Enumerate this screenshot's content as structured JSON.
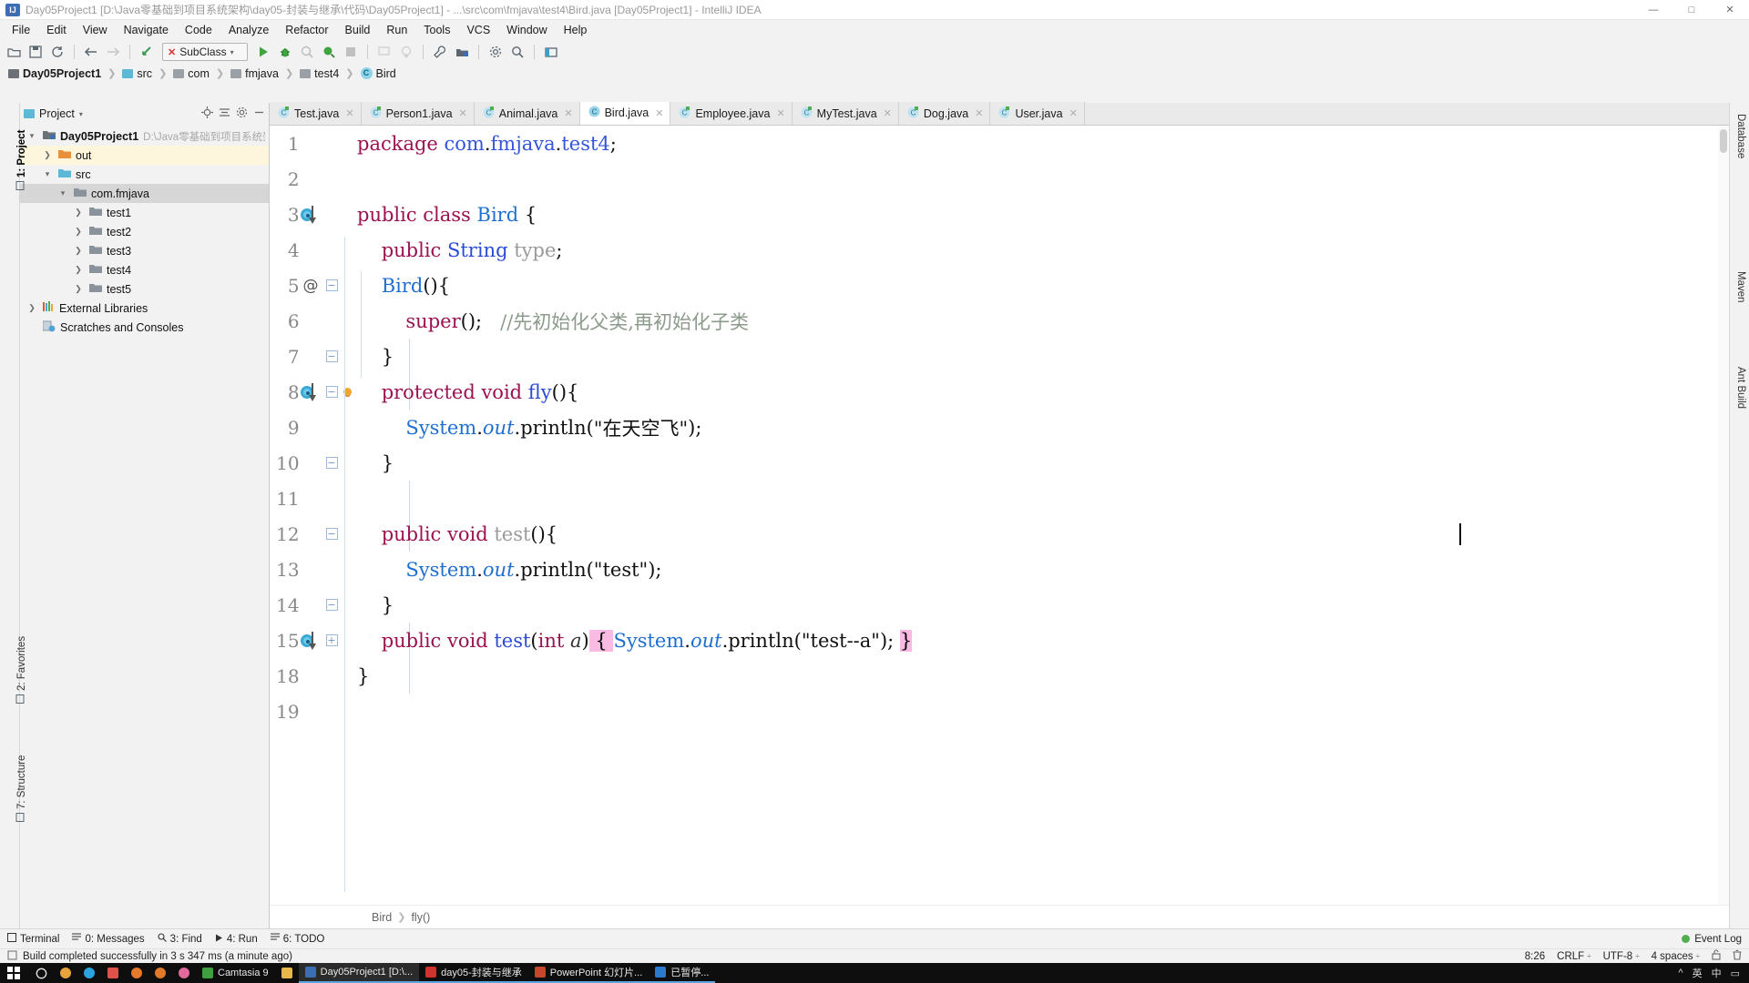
{
  "window": {
    "title": "Day05Project1 [D:\\Java零基础到项目系统架构\\day05-封装与继承\\代码\\Day05Project1] - ...\\src\\com\\fmjava\\test4\\Bird.java [Day05Project1] - IntelliJ IDEA",
    "app_badge": "IJ",
    "minimize": "—",
    "maximize": "□",
    "close": "✕"
  },
  "menubar": {
    "items": [
      "File",
      "Edit",
      "View",
      "Navigate",
      "Code",
      "Analyze",
      "Refactor",
      "Build",
      "Run",
      "Tools",
      "VCS",
      "Window",
      "Help"
    ]
  },
  "toolbar": {
    "run_config": {
      "label": "SubClass",
      "error_mark": "✕",
      "caret": "▾"
    },
    "icons": [
      "open-folder-icon",
      "save-all-icon",
      "sync-icon",
      "back-icon",
      "forward-icon",
      "flash-icon"
    ],
    "run_icons": [
      "run-icon",
      "debug-icon",
      "run-with-coverage-icon",
      "profile-icon",
      "stop-icon",
      "attach-icon",
      "update-icon"
    ],
    "right_icons": [
      "wrench-icon",
      "project-structure-icon",
      "settings-icon",
      "search-everywhere-icon",
      "layout-icon"
    ]
  },
  "breadcrumb": {
    "items": [
      {
        "label": "Day05Project1",
        "icon": "project-module-icon",
        "bold": true
      },
      {
        "label": "src",
        "icon": "source-folder-icon",
        "bold": false
      },
      {
        "label": "com",
        "icon": "folder-icon",
        "bold": false
      },
      {
        "label": "fmjava",
        "icon": "folder-icon",
        "bold": false
      },
      {
        "label": "test4",
        "icon": "folder-icon",
        "bold": false
      },
      {
        "label": "Bird",
        "icon": "class-icon",
        "bold": false
      }
    ],
    "separator": "❯"
  },
  "left_rail": {
    "tabs": [
      {
        "label": "1: Project",
        "active": true
      },
      {
        "label": "2: Favorites",
        "active": false
      },
      {
        "label": "7: Structure",
        "active": false
      }
    ]
  },
  "right_rail": {
    "tabs": [
      {
        "label": "Database",
        "active": false
      },
      {
        "label": "Maven",
        "active": false
      },
      {
        "label": "Ant Build",
        "active": false
      }
    ]
  },
  "project_panel": {
    "title": "Project",
    "title_caret": "▾",
    "actions": [
      "locate-icon",
      "collapse-all-icon",
      "settings-icon",
      "hide-icon"
    ],
    "tree": [
      {
        "depth": 0,
        "arrow": "▾",
        "icon": "project-module-icon",
        "label": "Day05Project1",
        "bold": true,
        "path": "D:\\Java零基础到项目系统架",
        "state": "normal"
      },
      {
        "depth": 1,
        "arrow": "❯",
        "icon": "out-folder-icon",
        "label": "out",
        "bold": false,
        "path": "",
        "state": "highlight"
      },
      {
        "depth": 1,
        "arrow": "▾",
        "icon": "source-folder-icon",
        "label": "src",
        "bold": false,
        "path": "",
        "state": "normal"
      },
      {
        "depth": 2,
        "arrow": "▾",
        "icon": "package-icon",
        "label": "com.fmjava",
        "bold": false,
        "path": "",
        "state": "selected"
      },
      {
        "depth": 3,
        "arrow": "❯",
        "icon": "package-icon",
        "label": "test1",
        "bold": false,
        "path": "",
        "state": "normal"
      },
      {
        "depth": 3,
        "arrow": "❯",
        "icon": "package-icon",
        "label": "test2",
        "bold": false,
        "path": "",
        "state": "normal"
      },
      {
        "depth": 3,
        "arrow": "❯",
        "icon": "package-icon",
        "label": "test3",
        "bold": false,
        "path": "",
        "state": "normal"
      },
      {
        "depth": 3,
        "arrow": "❯",
        "icon": "package-icon",
        "label": "test4",
        "bold": false,
        "path": "",
        "state": "normal"
      },
      {
        "depth": 3,
        "arrow": "❯",
        "icon": "package-icon",
        "label": "test5",
        "bold": false,
        "path": "",
        "state": "normal"
      },
      {
        "depth": 0,
        "arrow": "❯",
        "icon": "libraries-icon",
        "label": "External Libraries",
        "bold": false,
        "path": "",
        "state": "normal"
      },
      {
        "depth": 0,
        "arrow": "",
        "icon": "scratches-icon",
        "label": "Scratches and Consoles",
        "bold": false,
        "path": "",
        "state": "normal"
      }
    ]
  },
  "editor_tabs": [
    {
      "label": "Test.java",
      "active": false,
      "close": "✕"
    },
    {
      "label": "Person1.java",
      "active": false,
      "close": "✕"
    },
    {
      "label": "Animal.java",
      "active": false,
      "close": "✕"
    },
    {
      "label": "Bird.java",
      "active": true,
      "close": "✕"
    },
    {
      "label": "Employee.java",
      "active": false,
      "close": "✕"
    },
    {
      "label": "MyTest.java",
      "active": false,
      "close": "✕"
    },
    {
      "label": "Dog.java",
      "active": false,
      "close": "✕"
    },
    {
      "label": "User.java",
      "active": false,
      "close": "✕"
    }
  ],
  "code": {
    "lines": [
      {
        "num": "1",
        "gutter_icon": "",
        "fold": "",
        "lamp": false,
        "tokens": [
          {
            "t": "package ",
            "c": "kw"
          },
          {
            "t": "com",
            "c": "pkg"
          },
          {
            "t": ".",
            "c": "pln"
          },
          {
            "t": "fmjava",
            "c": "pkg"
          },
          {
            "t": ".",
            "c": "pln"
          },
          {
            "t": "test4",
            "c": "pkg"
          },
          {
            "t": ";",
            "c": "pln"
          }
        ]
      },
      {
        "num": "2",
        "gutter_icon": "",
        "fold": "",
        "lamp": false,
        "tokens": []
      },
      {
        "num": "3",
        "gutter_icon": "run",
        "fold": "",
        "lamp": false,
        "tokens": [
          {
            "t": "public class ",
            "c": "kw"
          },
          {
            "t": "Bird",
            "c": "cls"
          },
          {
            "t": " {",
            "c": "pln"
          }
        ]
      },
      {
        "num": "4",
        "gutter_icon": "",
        "fold": "",
        "lamp": false,
        "tokens": [
          {
            "t": "    ",
            "c": "pln"
          },
          {
            "t": "public ",
            "c": "kw"
          },
          {
            "t": "String",
            "c": "typ"
          },
          {
            "t": " ",
            "c": "pln"
          },
          {
            "t": "type",
            "c": "fld"
          },
          {
            "t": ";",
            "c": "pln"
          }
        ]
      },
      {
        "num": "5",
        "gutter_icon": "at",
        "fold": "start",
        "lamp": false,
        "tokens": [
          {
            "t": "    ",
            "c": "pln"
          },
          {
            "t": "Bird",
            "c": "cls"
          },
          {
            "t": "(){",
            "c": "pln"
          }
        ]
      },
      {
        "num": "6",
        "gutter_icon": "",
        "fold": "",
        "lamp": false,
        "tokens": [
          {
            "t": "        ",
            "c": "pln"
          },
          {
            "t": "super",
            "c": "kw"
          },
          {
            "t": "();",
            "c": "pln"
          },
          {
            "t": "   ",
            "c": "pln"
          },
          {
            "t": "//先初始化父类,再初始化子类",
            "c": "cmt"
          }
        ]
      },
      {
        "num": "7",
        "gutter_icon": "",
        "fold": "end",
        "lamp": false,
        "tokens": [
          {
            "t": "    }",
            "c": "pln"
          }
        ]
      },
      {
        "num": "8",
        "gutter_icon": "run",
        "fold": "start",
        "lamp": true,
        "tokens": [
          {
            "t": "    ",
            "c": "pln"
          },
          {
            "t": "protected void ",
            "c": "kw"
          },
          {
            "t": "fly",
            "c": "typ"
          },
          {
            "t": "(){",
            "c": "pln"
          }
        ]
      },
      {
        "num": "9",
        "gutter_icon": "",
        "fold": "",
        "lamp": false,
        "tokens": [
          {
            "t": "        ",
            "c": "pln"
          },
          {
            "t": "System",
            "c": "cls"
          },
          {
            "t": ".",
            "c": "pln"
          },
          {
            "t": "out",
            "c": "stat"
          },
          {
            "t": ".println(",
            "c": "pln"
          },
          {
            "t": "\"在天空飞\"",
            "c": "str"
          },
          {
            "t": ");",
            "c": "pln"
          }
        ]
      },
      {
        "num": "10",
        "gutter_icon": "",
        "fold": "end",
        "lamp": false,
        "tokens": [
          {
            "t": "    }",
            "c": "pln"
          }
        ]
      },
      {
        "num": "11",
        "gutter_icon": "",
        "fold": "",
        "lamp": false,
        "tokens": []
      },
      {
        "num": "12",
        "gutter_icon": "",
        "fold": "start",
        "lamp": false,
        "tokens": [
          {
            "t": "    ",
            "c": "pln"
          },
          {
            "t": "public void ",
            "c": "kw"
          },
          {
            "t": "test",
            "c": "fld"
          },
          {
            "t": "(){",
            "c": "pln"
          }
        ]
      },
      {
        "num": "13",
        "gutter_icon": "",
        "fold": "",
        "lamp": false,
        "tokens": [
          {
            "t": "        ",
            "c": "pln"
          },
          {
            "t": "System",
            "c": "cls"
          },
          {
            "t": ".",
            "c": "pln"
          },
          {
            "t": "out",
            "c": "stat"
          },
          {
            "t": ".println(",
            "c": "pln"
          },
          {
            "t": "\"test\"",
            "c": "str"
          },
          {
            "t": ");",
            "c": "pln"
          }
        ]
      },
      {
        "num": "14",
        "gutter_icon": "",
        "fold": "end",
        "lamp": false,
        "tokens": [
          {
            "t": "    }",
            "c": "pln"
          }
        ]
      },
      {
        "num": "15",
        "gutter_icon": "run",
        "fold": "plus",
        "lamp": false,
        "tokens": [
          {
            "t": "    ",
            "c": "pln"
          },
          {
            "t": "public void ",
            "c": "kw"
          },
          {
            "t": "test",
            "c": "typ"
          },
          {
            "t": "(",
            "c": "pln"
          },
          {
            "t": "int",
            "c": "kw"
          },
          {
            "t": " ",
            "c": "pln"
          },
          {
            "t": "a",
            "c": "prm"
          },
          {
            "t": ")",
            "c": "pln"
          },
          {
            "t": " { ",
            "c": "hl-pink"
          },
          {
            "t": "System",
            "c": "cls"
          },
          {
            "t": ".",
            "c": "pln"
          },
          {
            "t": "out",
            "c": "stat"
          },
          {
            "t": ".println(",
            "c": "pln"
          },
          {
            "t": "\"test--a\"",
            "c": "str"
          },
          {
            "t": "); ",
            "c": "pln"
          },
          {
            "t": "}",
            "c": "hl-pink"
          }
        ]
      },
      {
        "num": "18",
        "gutter_icon": "",
        "fold": "",
        "lamp": false,
        "tokens": [
          {
            "t": "}",
            "c": "pln"
          }
        ]
      },
      {
        "num": "19",
        "gutter_icon": "",
        "fold": "",
        "lamp": false,
        "tokens": []
      }
    ]
  },
  "editor_footer": {
    "crumbs": [
      "Bird",
      "fly()"
    ],
    "separator": "❯"
  },
  "bottom_bar": {
    "items": [
      {
        "label": "Terminal",
        "icon": "terminal-icon"
      },
      {
        "label": "0: Messages",
        "icon": "messages-icon"
      },
      {
        "label": "3: Find",
        "icon": "find-icon"
      },
      {
        "label": "4: Run",
        "icon": "run-icon"
      },
      {
        "label": "6: TODO",
        "icon": "todo-icon"
      }
    ],
    "event_log": "Event Log"
  },
  "status_bar": {
    "message": "Build completed successfully in 3 s 347 ms (a minute ago)",
    "message_icon": "build-icon",
    "caret_position": "8:26",
    "line_separator": "CRLF",
    "encoding": "UTF-8",
    "indent": "4 spaces",
    "lock_icon": "unlock-icon",
    "trash_icon": "trash-icon"
  },
  "taskbar": {
    "start": "windows-logo",
    "search": "cortana-circle",
    "pinned": [
      {
        "name": "chrome-icon",
        "color": "#e8a33d",
        "shape": "circ"
      },
      {
        "name": "qq-icon",
        "color": "#2aa3e0",
        "shape": "circ"
      },
      {
        "name": "app-icon-red",
        "color": "#e0514a",
        "shape": "sq"
      },
      {
        "name": "firefox-icon",
        "color": "#e8792b",
        "shape": "circ"
      },
      {
        "name": "app-icon-orange",
        "color": "#e07a2b",
        "shape": "circ"
      },
      {
        "name": "app-icon-pink",
        "color": "#e06a9a",
        "shape": "circ"
      }
    ],
    "apps": [
      {
        "label": "Camtasia 9",
        "color": "#3fa03f",
        "active": false,
        "running": false
      },
      {
        "label": "",
        "color": "#e8b94a",
        "active": false,
        "running": false
      },
      {
        "label": "Day05Project1 [D:\\...",
        "color": "#3c6eb4",
        "active": true,
        "running": true
      },
      {
        "label": "day05-封装与继承",
        "color": "#d0342c",
        "active": false,
        "running": true
      },
      {
        "label": "PowerPoint 幻灯片...",
        "color": "#c4482b",
        "active": false,
        "running": true
      },
      {
        "label": "已暂停...",
        "color": "#2a7ad0",
        "active": false,
        "running": true
      }
    ],
    "tray": [
      "^",
      "英",
      "中",
      "▭"
    ]
  }
}
